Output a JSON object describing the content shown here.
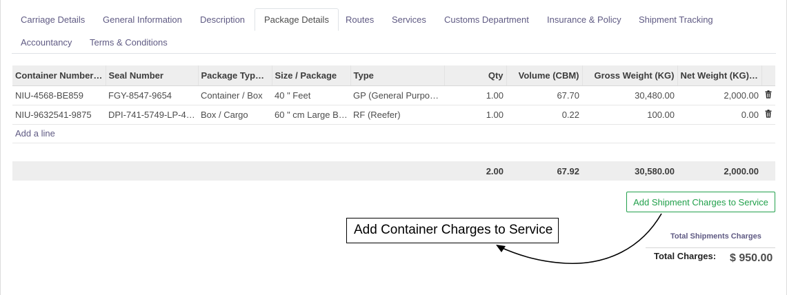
{
  "tabs": [
    {
      "label": "Carriage Details"
    },
    {
      "label": "General Information"
    },
    {
      "label": "Description"
    },
    {
      "label": "Package Details"
    },
    {
      "label": "Routes"
    },
    {
      "label": "Services"
    },
    {
      "label": "Customs Department"
    },
    {
      "label": "Insurance & Policy"
    },
    {
      "label": "Shipment Tracking"
    },
    {
      "label": "Accountancy"
    },
    {
      "label": "Terms & Conditions"
    }
  ],
  "active_tab": "Package Details",
  "table": {
    "headers": {
      "container_number": "Container Number…",
      "seal_number": "Seal Number",
      "package_type": "Package Type…",
      "size_package": "Size / Package",
      "type": "Type",
      "qty": "Qty",
      "volume": "Volume (CBM)",
      "gross_weight": "Gross Weight (KG)",
      "net_weight": "Net Weight (KG)…"
    },
    "rows": [
      {
        "container_number": "NIU-4568-BE859",
        "seal_number": "FGY-8547-9654",
        "package_type": "Container / Box",
        "size_package": "40 \" Feet",
        "type": "GP (General Purpo…",
        "qty": "1.00",
        "volume": "67.70",
        "gross_weight": "30,480.00",
        "net_weight": "2,000.00"
      },
      {
        "container_number": "NIU-9632541-9875",
        "seal_number": "DPI-741-5749-LP-4…",
        "package_type": "Box / Cargo",
        "size_package": "60 \" cm Large Box",
        "type": "RF (Reefer)",
        "qty": "1.00",
        "volume": "0.22",
        "gross_weight": "100.00",
        "net_weight": "0.00"
      }
    ],
    "add_line": "Add a line",
    "totals": {
      "qty": "2.00",
      "volume": "67.92",
      "gross_weight": "30,580.00",
      "net_weight": "2,000.00"
    }
  },
  "actions": {
    "add_shipment_charges": "Add Shipment Charges to Service"
  },
  "annotation": {
    "callout_text": "Add Container Charges to Service"
  },
  "summary": {
    "link_label": "Total Shipments Charges",
    "total_label": "Total Charges:",
    "total_value": "$ 950.00"
  },
  "icons": {
    "delete": "trash-icon"
  }
}
